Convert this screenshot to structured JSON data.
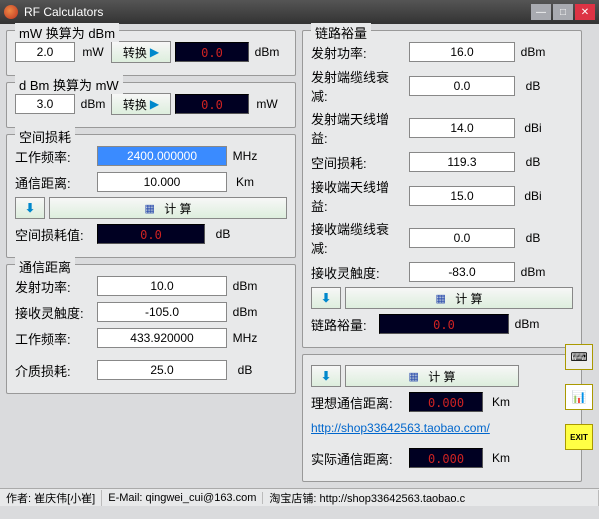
{
  "window": {
    "title": "RF Calculators"
  },
  "mw_to_dbm": {
    "title": "mW 换算为 dBm",
    "value": "2.0",
    "unit_in": "mW",
    "convert": "转换",
    "result": "0.0",
    "unit_out": "dBm"
  },
  "dbm_to_mw": {
    "title": "d Bm 换算为 mW",
    "value": "3.0",
    "unit_in": "dBm",
    "convert": "转换",
    "result": "0.0",
    "unit_out": "mW"
  },
  "space_loss": {
    "title": "空间损耗",
    "freq_lbl": "工作频率:",
    "freq": "2400.000000",
    "freq_unit": "MHz",
    "dist_lbl": "通信距离:",
    "dist": "10.000",
    "dist_unit": "Km",
    "calc": "计 算",
    "loss_lbl": "空间损耗值:",
    "loss": "0.0",
    "loss_unit": "dB"
  },
  "comm_dist": {
    "title": "通信距离",
    "tx_lbl": "发射功率:",
    "tx": "10.0",
    "tx_unit": "dBm",
    "rx_lbl": "接收灵触度:",
    "rx": "-105.0",
    "rx_unit": "dBm",
    "freq_lbl": "工作频率:",
    "freq": "433.920000",
    "freq_unit": "MHz",
    "med_lbl": "介质损耗:",
    "med": "25.0",
    "med_unit": "dB"
  },
  "link_margin": {
    "title": "链路裕量",
    "rows": [
      {
        "lbl": "发射功率:",
        "val": "16.0",
        "unit": "dBm"
      },
      {
        "lbl": "发射端缆线衰减:",
        "val": "0.0",
        "unit": "dB"
      },
      {
        "lbl": "发射端天线增益:",
        "val": "14.0",
        "unit": "dBi"
      },
      {
        "lbl": "空间损耗:",
        "val": "119.3",
        "unit": "dB"
      },
      {
        "lbl": "接收端天线增益:",
        "val": "15.0",
        "unit": "dBi"
      },
      {
        "lbl": "接收端缆线衰减:",
        "val": "0.0",
        "unit": "dB"
      },
      {
        "lbl": "接收灵触度:",
        "val": "-83.0",
        "unit": "dBm"
      }
    ],
    "calc": "计 算",
    "margin_lbl": "链路裕量:",
    "margin": "0.0",
    "margin_unit": "dBm"
  },
  "right_bottom": {
    "calc": "计 算",
    "ideal_lbl": "理想通信距离:",
    "ideal": "0.000",
    "ideal_unit": "Km",
    "url": "http://shop33642563.taobao.com/",
    "real_lbl": "实际通信距离:",
    "real": "0.000",
    "real_unit": "Km"
  },
  "status": {
    "author_lbl": "作者:",
    "author": "崔庆伟[小崔]",
    "email_lbl": "E-Mail:",
    "email": "qingwei_cui@163.com",
    "shop_lbl": "淘宝店铺:",
    "shop": "http://shop33642563.taobao.c"
  }
}
